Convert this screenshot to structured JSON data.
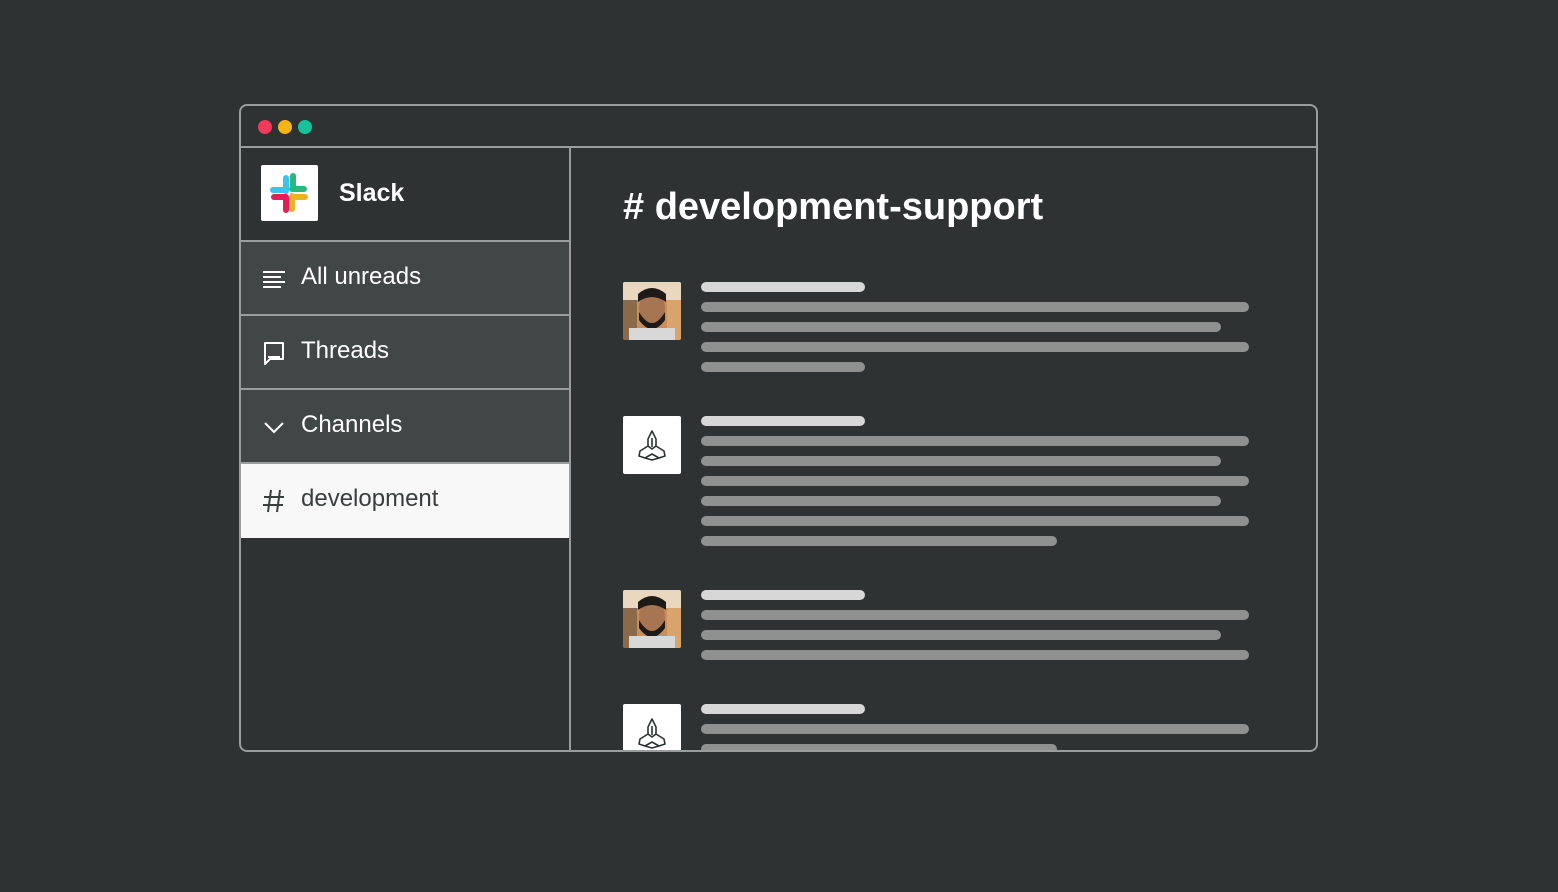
{
  "window": {
    "controls": {
      "close_color": "#f23a5a",
      "minimize_color": "#f5b416",
      "zoom_color": "#14c39a"
    }
  },
  "app": {
    "name": "Slack",
    "logo_icon": "slack-logo-icon"
  },
  "sidebar": {
    "items": [
      {
        "label": "All unreads",
        "icon": "list-lines-icon",
        "active": false
      },
      {
        "label": "Threads",
        "icon": "thread-bubble-icon",
        "active": false
      },
      {
        "label": "Channels",
        "icon": "chevron-down-icon",
        "active": false
      },
      {
        "label": "development",
        "icon": "hash-icon",
        "active": true
      }
    ]
  },
  "channel": {
    "title": "# development-support"
  },
  "messages": [
    {
      "avatar": "person-avatar",
      "line_count": 4
    },
    {
      "avatar": "bot-logo-icon",
      "line_count": 6
    },
    {
      "avatar": "person-avatar",
      "line_count": 3
    },
    {
      "avatar": "bot-logo-icon",
      "line_count": 2
    }
  ],
  "colors": {
    "background": "#2e3233",
    "panel": "#414647",
    "border": "#9a9d9d",
    "active_item": "#f8f8f8",
    "placeholder_line": "#8e9190",
    "placeholder_name": "#d6d7d6"
  }
}
